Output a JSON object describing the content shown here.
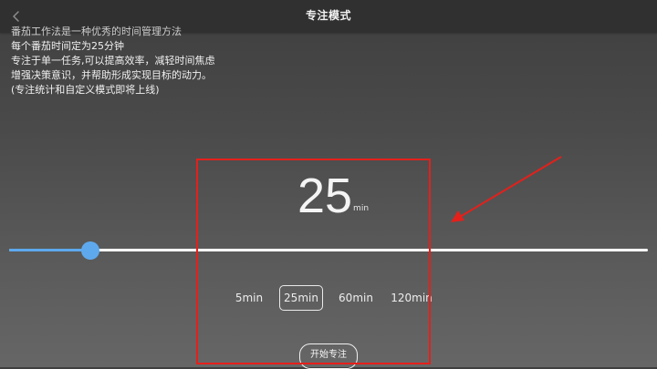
{
  "header": {
    "title": "专注模式"
  },
  "description": {
    "lines": [
      "番茄工作法是一种优秀的时间管理方法",
      "每个番茄时间定为25分钟",
      "专注于单一任务,可以提高效率，减轻时间焦虑",
      "增强决策意识，并帮助形成实现目标的动力。",
      "(专注统计和自定义模式即将上线)"
    ]
  },
  "timer": {
    "value": "25",
    "unit": "min"
  },
  "slider": {
    "value_fraction": 0.127
  },
  "presets": {
    "options": [
      "5min",
      "25min",
      "60min",
      "120min"
    ],
    "selected_index": 1
  },
  "start_button": {
    "label": "开始专注"
  },
  "colors": {
    "accent": "#5ea9ee",
    "annotation": "#e4201b",
    "header_bg": "#303030"
  }
}
